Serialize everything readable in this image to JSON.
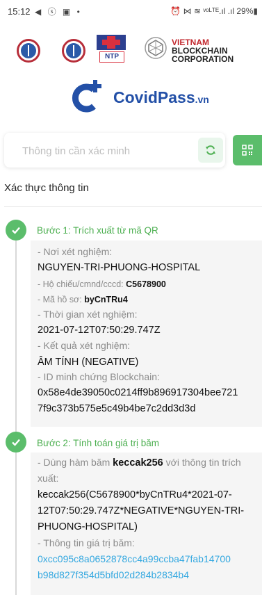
{
  "status_bar": {
    "time": "15:12",
    "left_icons": "◀ ⓢ ▣ •",
    "right": "⏰ ⋈ ≋ ᵛᵒᴸᵀᴱ.ıl .ıl 29%▮"
  },
  "logos": {
    "ntp_label": "NTP",
    "vbc_line1": "VIETNAM",
    "vbc_line2": "BLOCKCHAIN",
    "vbc_line3": "CORPORATION"
  },
  "brand": {
    "name": "CovidPass",
    "suffix": ".vn"
  },
  "search": {
    "placeholder": "Thông tin cần xác minh",
    "value": ""
  },
  "section_title": "Xác thực thông tin",
  "step1": {
    "title": "Bước 1: Trích xuất từ mã QR",
    "facility_label": "- Nơi xét nghiệm:",
    "facility_value": "NGUYEN-TRI-PHUONG-HOSPITAL",
    "passport_label": "- Hộ chiếu/cmnd/cccd:",
    "passport_value": "C5678900",
    "record_label": "- Mã hồ sơ:",
    "record_value": "byCnTRu4",
    "time_label": "- Thời gian xét nghiệm:",
    "time_value": "2021-07-12T07:50:29.747Z",
    "result_label": "- Kết quả xét nghiệm:",
    "result_value": "ÂM TÍNH (NEGATIVE)",
    "proof_label": "- ID minh chứng Blockchain:",
    "proof_line1": "0x58e4de39050c0214ff9b896917304bee721",
    "proof_line2": "7f9c373b575e5c49b4be7c2dd3d3d"
  },
  "step2": {
    "title": "Bước 2: Tính toán giá trị băm",
    "desc_pre": "- Dùng hàm băm",
    "desc_bold": "keccak256",
    "desc_post": "với thông tin trích",
    "desc_line2": "xuất:",
    "formula_line1": "keccak256(C5678900*byCnTRu4*2021-07-",
    "formula_line2": "12T07:50:29.747Z*NEGATIVE*NGUYEN-TRI-",
    "formula_line3": "PHUONG-HOSPITAL)",
    "hash_label": "- Thông tin giá trị băm:",
    "hash_line1": "0xcc095c8a0652878cc4a99ccba47fab14700",
    "hash_line2": "b98d827f354d5bfd02d284b2834b4"
  },
  "colors": {
    "green": "#5bbd6b",
    "brand_blue": "#2350a7",
    "hash_blue": "#34a8e0",
    "seal_red": "#b72e3a"
  }
}
